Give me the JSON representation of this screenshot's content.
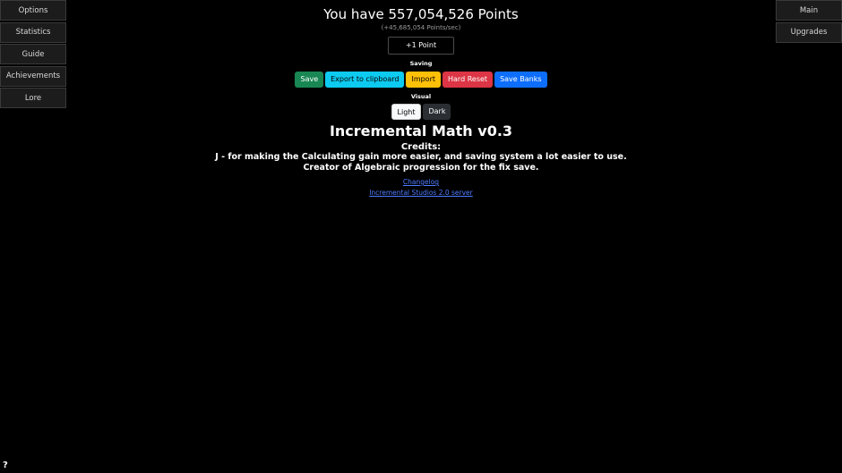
{
  "nav_left": [
    "Options",
    "Statistics",
    "Guide",
    "Achievements",
    "Lore"
  ],
  "nav_right": [
    "Main",
    "Upgrades"
  ],
  "points": {
    "title": "You have 557,054,526 Points",
    "rate": "(+45,685,054 Points/sec)",
    "click_button": "+1 Point"
  },
  "saving": {
    "label": "Saving",
    "buttons": [
      "Save",
      "Export to clipboard",
      "Import",
      "Hard Reset",
      "Save Banks"
    ],
    "colors": {
      "save": "#198754",
      "export": "#0dcaf0",
      "import": "#ffc107",
      "reset": "#dc3545",
      "banks": "#0d6efd"
    }
  },
  "visual": {
    "label": "Visual",
    "buttons": [
      "Light",
      "Dark"
    ]
  },
  "game_title": "Incremental Math v0.3",
  "credits": {
    "heading": "Credits:",
    "line1": "J - for making the Calculating gain more easier, and saving system a lot easier to use.",
    "line2": "Creator of Algebraic progression for the fix save."
  },
  "links": [
    "Changelog",
    "Incremental Studios 2.0 server"
  ],
  "help": "?"
}
